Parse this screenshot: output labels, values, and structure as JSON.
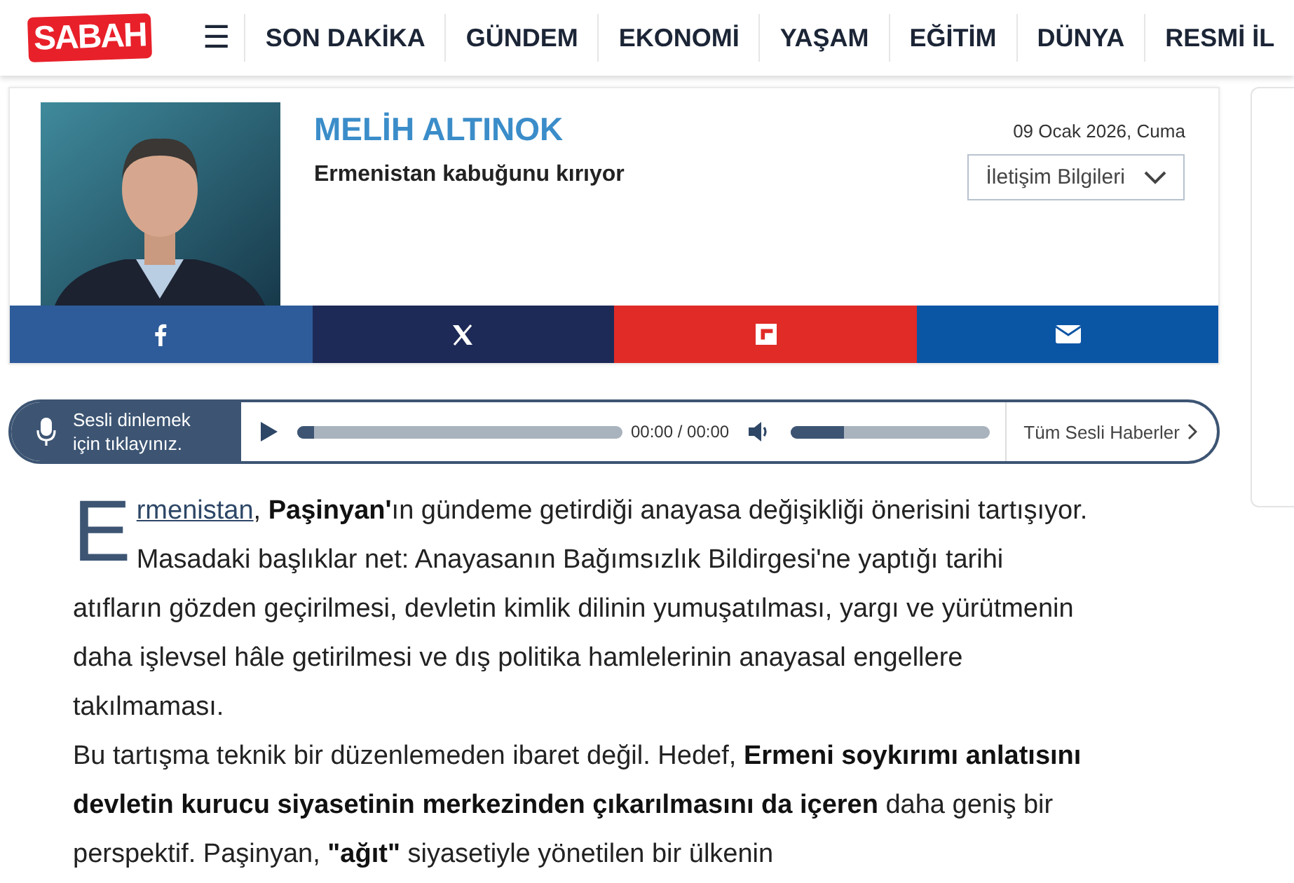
{
  "header": {
    "logo": "SABAH",
    "menu_icon": "☰",
    "nav": [
      "SON DAKİKA",
      "GÜNDEM",
      "EKONOMİ",
      "YAŞAM",
      "EĞİTİM",
      "DÜNYA",
      "RESMİ İL"
    ]
  },
  "author": {
    "name": "MELİH ALTINOK",
    "title": "Ermenistan kabuğunu kırıyor",
    "date": "09 Ocak 2026, Cuma",
    "contact_button": "İletişim Bilgileri"
  },
  "share": [
    {
      "kind": "facebook",
      "color": "#2e5b9a"
    },
    {
      "kind": "x",
      "color": "#1d2a57"
    },
    {
      "kind": "flipboard",
      "color": "#e02b27"
    },
    {
      "kind": "mail",
      "color": "#0b55a5"
    }
  ],
  "audio": {
    "prompt_line1": "Sesli dinlemek",
    "prompt_line2": "için tıklayınız.",
    "time": "00:00 / 00:00",
    "progress": {
      "level": 0.05
    },
    "volume": {
      "level": 0.27
    },
    "all_link": "Tüm Sesli Haberler"
  },
  "article": {
    "drop_cap": "E",
    "link": "rmenistan",
    "lead_rest": ", **Paşinyan'**ın gündeme getirdiği anayasa değişikliği önerisini tartışıyor. Masadaki başlıklar net: Anayasanın Bağımsızlık Bildirgesi'ne yaptığı tarihi atıfların gözden geçirilmesi, devletin kimlik dilinin yumuşatılması, yargı ve yürütmenin daha işlevsel hâle getirilmesi ve dış politika hamlelerinin anayasal engellere takılmaması.",
    "paragraphs": [
      "Bu tartışma teknik bir düzenlemeden ibaret değil. Hedef, **Ermeni soykırımı anlatısını devletin kurucu siyasetinin merkezinden çıkarılmasını da içeren** daha geniş bir perspektif. Paşinyan, **\"ağıt\"** siyasetiyle yönetilen bir ülkenin"
    ]
  }
}
